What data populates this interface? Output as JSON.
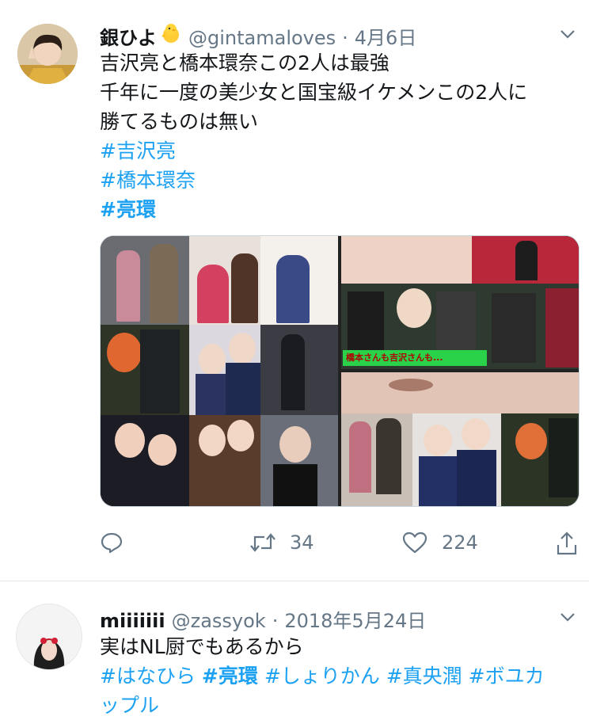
{
  "tweet1": {
    "display_name": "銀ひよ",
    "handle": "@gintamaloves",
    "separator": "·",
    "date": "4月6日",
    "lines": [
      "吉沢亮と橋本環奈この2人は最強",
      "千年に一度の美少女と国宝級イケメンこの2人に",
      "勝てるものは無い"
    ],
    "hashtags": [
      "#吉沢亮",
      "#橋本環奈",
      "#亮環"
    ],
    "media_overlay_text": "橋本さんも吉沢さんも...",
    "actions": {
      "reply_icon": "reply-icon",
      "retweet_icon": "retweet-icon",
      "retweet_count": "34",
      "like_icon": "heart-icon",
      "like_count": "224",
      "share_icon": "share-icon"
    },
    "badge_icon": "chick-emoji"
  },
  "tweet2": {
    "display_name": "miiiiiii",
    "handle": "@zassyok",
    "separator": "·",
    "date": "2018年5月24日",
    "text": "実はNL厨でもあるから",
    "hashtags_line1": [
      "#はなひら",
      "#亮環",
      "#しょりかん",
      "#真央潤",
      "#ボユカ"
    ],
    "hashtags_line2": "ップル"
  },
  "colors": {
    "link": "#1da1f2",
    "secondary": "#657786",
    "primary": "#14171a",
    "divider": "#e1e8ed"
  }
}
